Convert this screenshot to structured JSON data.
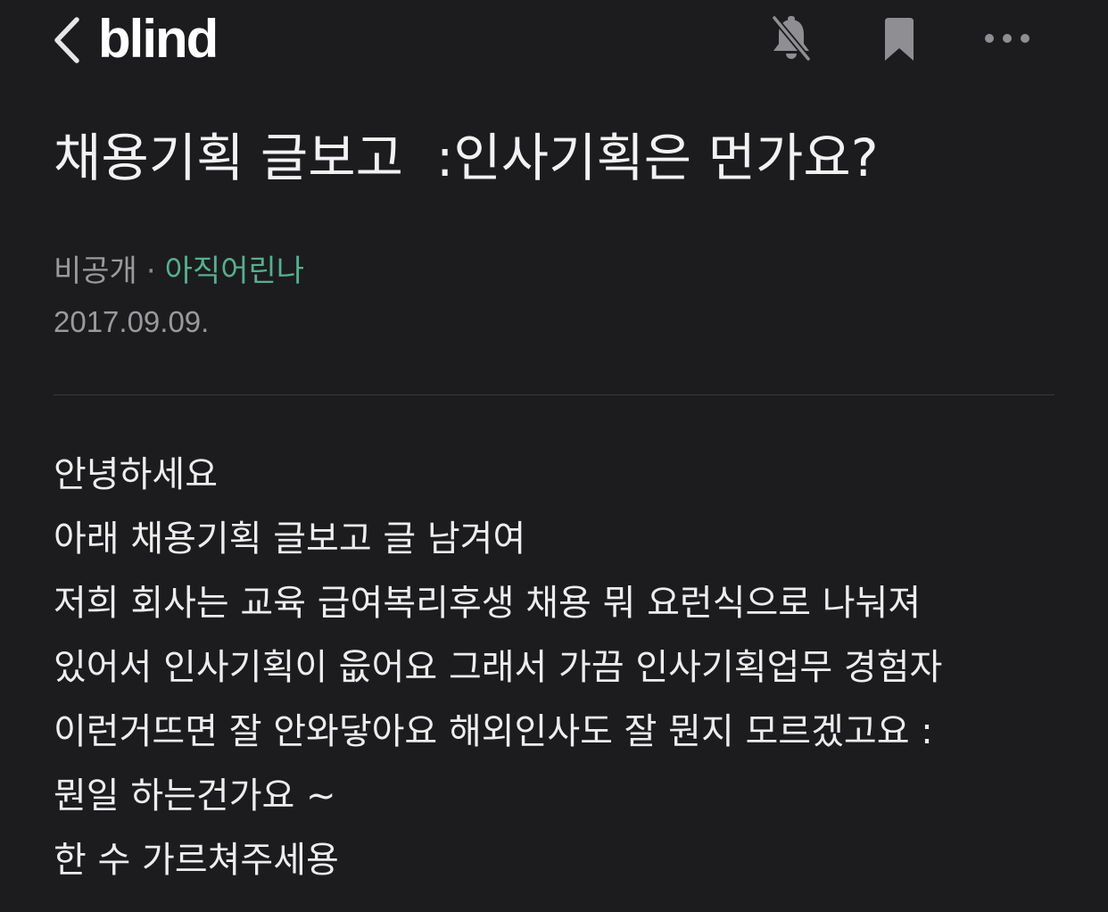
{
  "app": {
    "logo_text": "blind"
  },
  "header": {
    "icons": [
      "back-chevron-icon",
      "bell-off-icon",
      "bookmark-icon",
      "more-horizontal-icon"
    ]
  },
  "post": {
    "title": "채용기획 글보고  :인사기획은 먼가요?",
    "author_company": "비공개",
    "separator": "·",
    "author_nickname": "아직어린나",
    "date": "2017.09.09.",
    "body_lines": [
      "안녕하세요",
      "아래 채용기획 글보고 글 남겨여",
      "저희 회사는 교육 급여복리후생 채용 뭐 요런식으로 나눠져",
      "있어서 인사기획이 읎어요 그래서 가끔 인사기획업무 경험자",
      "이런거뜨면 잘 안와닿아요 해외인사도 잘 뭔지 모르겠고요 :",
      "뭔일 하는건가요 ~",
      "한 수 가르쳐주세용"
    ]
  },
  "colors": {
    "background": "#1c1c1e",
    "text_primary": "#ededed",
    "text_secondary": "#9a9a9e",
    "nickname_accent": "#55b08e",
    "icon_muted": "#8e8e93",
    "divider": "#3a3a3c"
  }
}
